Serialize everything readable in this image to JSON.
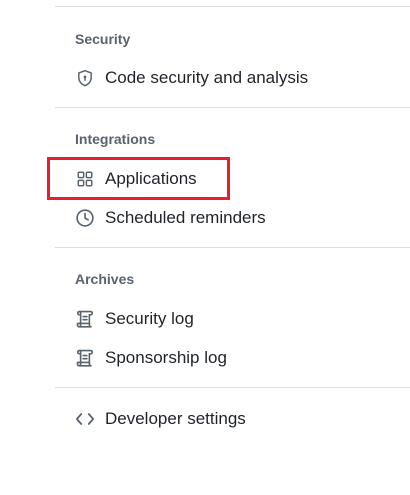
{
  "sections": {
    "security": {
      "heading": "Security",
      "items": [
        {
          "label": "Code security and analysis",
          "icon": "shield-lock-icon"
        }
      ]
    },
    "integrations": {
      "heading": "Integrations",
      "items": [
        {
          "label": "Applications",
          "icon": "apps-grid-icon",
          "highlighted": true
        },
        {
          "label": "Scheduled reminders",
          "icon": "clock-icon"
        }
      ]
    },
    "archives": {
      "heading": "Archives",
      "items": [
        {
          "label": "Security log",
          "icon": "log-icon"
        },
        {
          "label": "Sponsorship log",
          "icon": "log-icon"
        }
      ]
    },
    "developer": {
      "items": [
        {
          "label": "Developer settings",
          "icon": "code-icon"
        }
      ]
    }
  },
  "colors": {
    "highlight_border": "#e5202e",
    "heading_text": "#59636e",
    "item_text": "#1f2328",
    "divider": "#d8dee4"
  }
}
